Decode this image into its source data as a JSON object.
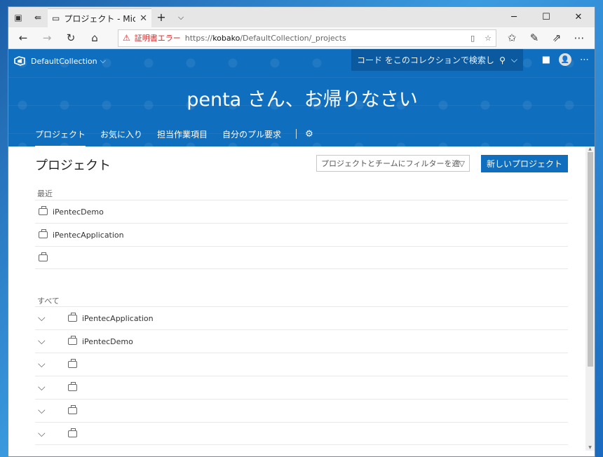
{
  "browser": {
    "tab_title": "プロジェクト - Microsoft Te",
    "tab_close": "✕",
    "new_tab": "+",
    "tab_list": "⌵",
    "cert_error": "証明書エラー",
    "url_prefix": "https://",
    "url_host": "kobako",
    "url_path": "/DefaultCollection/_projects"
  },
  "ado": {
    "collection": "DefaultCollection",
    "search_placeholder": "コード をこのコレクションで検索しま",
    "welcome": "penta さん、お帰りなさい",
    "tabs": [
      "プロジェクト",
      "お気に入り",
      "担当作業項目",
      "自分のプル要求"
    ]
  },
  "content": {
    "title": "プロジェクト",
    "filter_placeholder": "プロジェクトとチームにフィルターを適用",
    "new_project": "新しいプロジェクト",
    "recent_label": "最近",
    "recent": [
      "iPentecDemo",
      "iPentecApplication",
      ""
    ],
    "all_label": "すべて",
    "all": [
      "iPentecApplication",
      "iPentecDemo",
      "",
      "",
      "",
      ""
    ]
  },
  "colors": {
    "accent": "#106ebe",
    "warning": "#d12b2b"
  }
}
